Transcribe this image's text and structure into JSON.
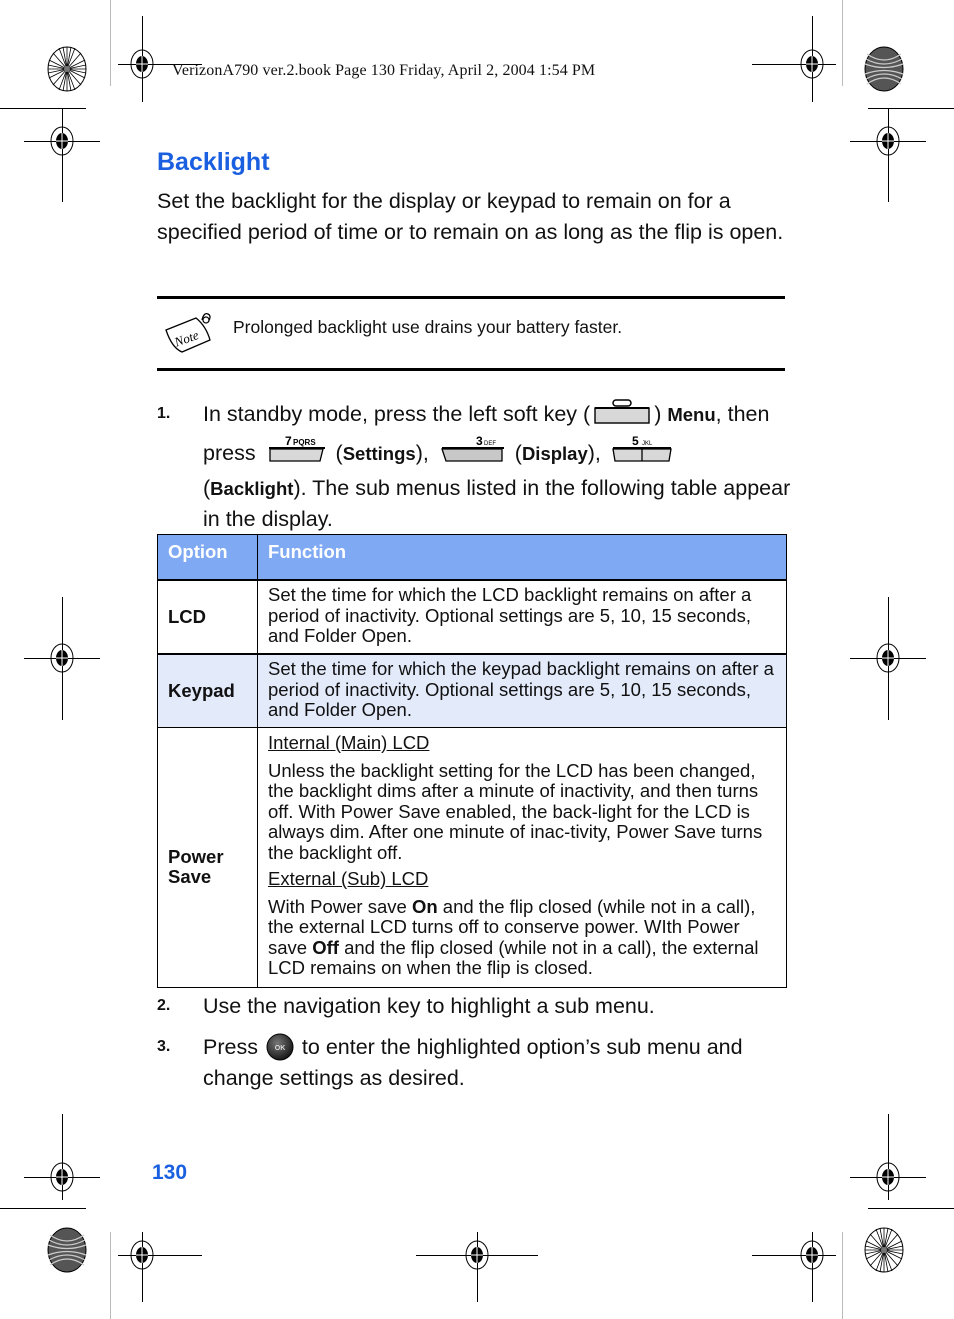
{
  "print_header": "VerizonA790 ver.2.book  Page 130  Friday, April 2, 2004  1:54 PM",
  "section": {
    "title": "Backlight",
    "intro": "Set the backlight for the display or keypad to remain on for a specified period of time or to remain on as long as the flip is open."
  },
  "note": {
    "icon": "note-icon",
    "icon_label": "Note",
    "text": "Prolonged backlight use drains your battery faster."
  },
  "steps": [
    {
      "number": "1.",
      "parts": {
        "t1": "In standby mode, press the left soft key (",
        "t2": ") ",
        "menu": "Menu",
        "t3": ", then press ",
        "key1": "7PQRS",
        "t4": " (",
        "settings": "Settings",
        "t5": "), ",
        "key2": "3DEF",
        "t6": " (",
        "display": "Display",
        "t7": "), ",
        "key3": "5JKL",
        "t8": " (",
        "backlight": "Backlight",
        "t9": "). The sub menus listed in the following table appear in the display."
      }
    },
    {
      "number": "2.",
      "text": "Use the navigation key to highlight a sub menu."
    },
    {
      "number": "3.",
      "parts": {
        "t1": "Press ",
        "ok_key": "OK",
        "t2": " to enter the highlighted option’s sub menu and change settings as desired."
      }
    }
  ],
  "table": {
    "headers": [
      "Option",
      "Function"
    ],
    "rows": [
      {
        "option": "LCD",
        "function": "Set the time for which the LCD backlight remains on after a period of inactivity. Optional settings are 5, 10, 15 seconds, and Folder Open."
      },
      {
        "option": "Keypad",
        "function": "Set the time for which the keypad backlight remains on after a period of inactivity. Optional settings are 5, 10, 15 seconds, and Folder Open."
      },
      {
        "option": "Power Save",
        "internal_heading": "Internal (Main) LCD",
        "internal_text": "Unless the backlight setting for the LCD has been changed, the backlight dims after a minute of inactivity, and then turns off. With Power Save enabled, the back-light for the LCD is always dim. After one minute of inac-tivity, Power Save turns the backlight off.",
        "external_heading": "External (Sub) LCD",
        "external_parts": {
          "t1": "With Power save ",
          "on": "On",
          "t2": " and the flip closed (while not in a call), the external LCD turns off to conserve power. WIth Power save ",
          "off": "Off",
          "t3": " and the flip closed (while not in a call), the external LCD remains on when the flip is closed."
        }
      }
    ]
  },
  "page_number": "130",
  "colors": {
    "accent": "#1a5fe0",
    "table_header": "#7fa9f3",
    "table_alt_row": "#e3eafa"
  }
}
